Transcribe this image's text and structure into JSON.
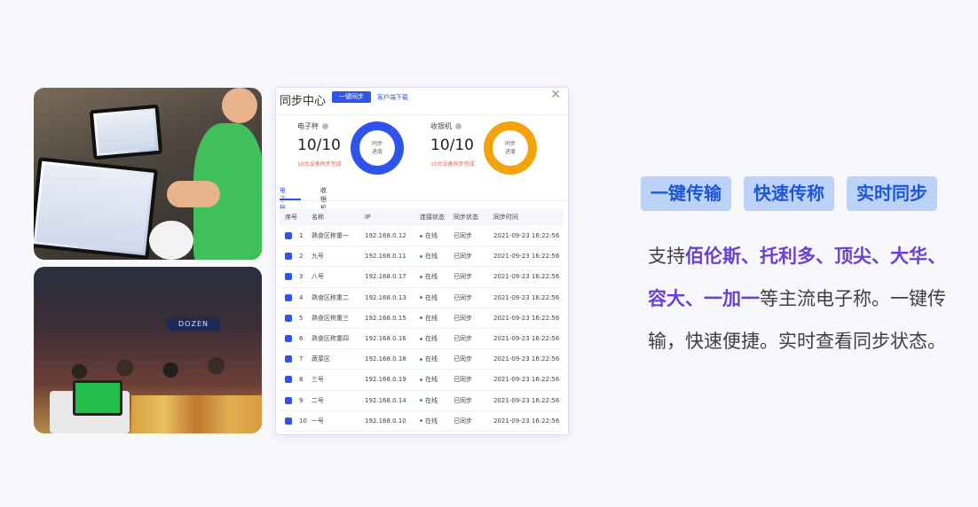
{
  "panel": {
    "title": "同步中心",
    "primary_button": "一键同步",
    "help_link": "客户端下载",
    "stats": [
      {
        "label": "电子秤",
        "value": "10/10",
        "note": "10台设备同步完成",
        "donut_center": [
          "同步",
          "进度"
        ],
        "color": "#2f54eb"
      },
      {
        "label": "收银机",
        "value": "10/10",
        "note": "10台设备同步完成",
        "donut_center": [
          "同步",
          "进度"
        ],
        "color": "#f5a30a"
      }
    ],
    "tabs": [
      "电子秤",
      "收银机"
    ],
    "columns": [
      "序号",
      "名称",
      "IP",
      "连接状态",
      "同步状态",
      "同步时间"
    ],
    "rows": [
      {
        "no": "1",
        "name": "熟食区称重一",
        "ip": "192.168.0.12",
        "status": "在线",
        "sync": "已同步",
        "time": "2021-09-23 16:22:56"
      },
      {
        "no": "2",
        "name": "九号",
        "ip": "192.168.0.11",
        "status": "在线",
        "sync": "已同步",
        "time": "2021-09-23 16:22:56"
      },
      {
        "no": "3",
        "name": "八号",
        "ip": "192.168.0.17",
        "status": "在线",
        "sync": "已同步",
        "time": "2021-09-23 16:22:56"
      },
      {
        "no": "4",
        "name": "熟食区称重二",
        "ip": "192.168.0.13",
        "status": "在线",
        "sync": "已同步",
        "time": "2021-09-23 16:22:56"
      },
      {
        "no": "5",
        "name": "熟食区称重三",
        "ip": "192.168.0.15",
        "status": "在线",
        "sync": "已同步",
        "time": "2021-09-23 16:22:56"
      },
      {
        "no": "6",
        "name": "熟食区称重四",
        "ip": "192.168.0.16",
        "status": "在线",
        "sync": "已同步",
        "time": "2021-09-23 16:22:56"
      },
      {
        "no": "7",
        "name": "蔬菜区",
        "ip": "192.168.0.18",
        "status": "在线",
        "sync": "已同步",
        "time": "2021-09-23 16:22:56"
      },
      {
        "no": "8",
        "name": "三号",
        "ip": "192.168.0.19",
        "status": "在线",
        "sync": "已同步",
        "time": "2021-09-23 16:22:56"
      },
      {
        "no": "9",
        "name": "二号",
        "ip": "192.168.0.14",
        "status": "在线",
        "sync": "已同步",
        "time": "2021-09-23 16:22:56"
      },
      {
        "no": "10",
        "name": "一号",
        "ip": "192.168.0.10",
        "status": "在线",
        "sync": "已同步",
        "time": "2021-09-23 16:22:56"
      }
    ]
  },
  "tags": [
    "一键传输",
    "快速传称",
    "实时同步"
  ],
  "description": {
    "lead": "支持",
    "brands1": "佰伦斯、托利多、顶尖、大华、",
    "brands2": "容大、一加一",
    "rest": "等主流电子称。一键传输，快速便捷。实时查看同步状态。"
  },
  "photo_signage": "DOZEN",
  "colors": {
    "accent": "#2f54eb",
    "orange": "#f5a30a",
    "highlight": "#6a3fd8",
    "tag_bg": "#bcd3f7",
    "tag_text": "#1f56d8"
  }
}
